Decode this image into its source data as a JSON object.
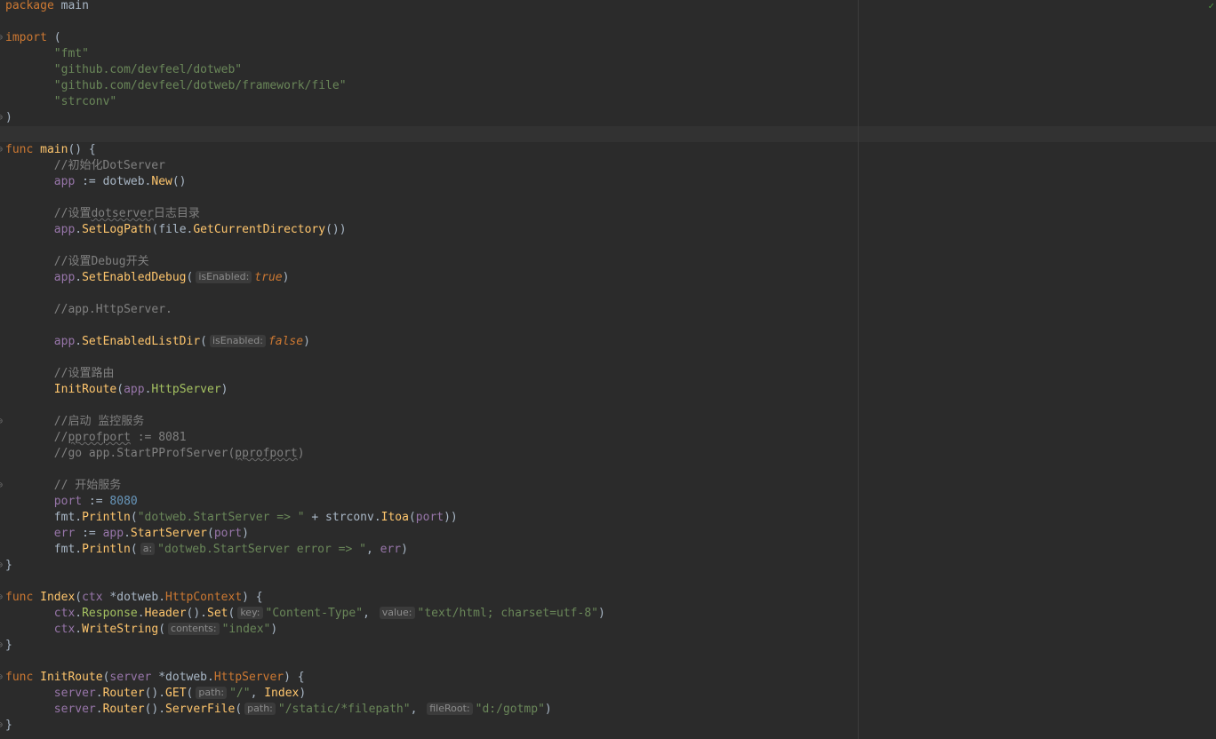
{
  "editor": {
    "inspection_icon": "checkmark-icon",
    "lines": [
      {
        "tokens": [
          {
            "c": "kw",
            "t": "package"
          },
          {
            "c": "plain",
            "t": " main"
          }
        ]
      },
      {
        "tokens": []
      },
      {
        "fold": true,
        "tokens": [
          {
            "c": "kw",
            "t": "import"
          },
          {
            "c": "plain",
            "t": " ("
          }
        ]
      },
      {
        "tokens": [
          {
            "c": "plain",
            "t": "       "
          },
          {
            "c": "str",
            "t": "\"fmt\""
          }
        ]
      },
      {
        "tokens": [
          {
            "c": "plain",
            "t": "       "
          },
          {
            "c": "str",
            "t": "\"github.com/devfeel/dotweb\""
          }
        ]
      },
      {
        "tokens": [
          {
            "c": "plain",
            "t": "       "
          },
          {
            "c": "str",
            "t": "\"github.com/devfeel/dotweb/framework/file\""
          }
        ]
      },
      {
        "tokens": [
          {
            "c": "plain",
            "t": "       "
          },
          {
            "c": "str",
            "t": "\"strconv\""
          }
        ]
      },
      {
        "fold": true,
        "tokens": [
          {
            "c": "plain",
            "t": ")"
          }
        ]
      },
      {
        "tokens": []
      },
      {
        "fold": true,
        "tokens": [
          {
            "c": "kw",
            "t": "func"
          },
          {
            "c": "plain",
            "t": " "
          },
          {
            "c": "fn",
            "t": "main"
          },
          {
            "c": "plain",
            "t": "() {"
          }
        ]
      },
      {
        "tokens": [
          {
            "c": "plain",
            "t": "       "
          },
          {
            "c": "cm",
            "t": "//初始化DotServer"
          }
        ]
      },
      {
        "tokens": [
          {
            "c": "plain",
            "t": "       "
          },
          {
            "c": "var",
            "t": "app"
          },
          {
            "c": "plain",
            "t": " := dotweb."
          },
          {
            "c": "fn",
            "t": "New"
          },
          {
            "c": "plain",
            "t": "()"
          }
        ]
      },
      {
        "tokens": []
      },
      {
        "tokens": [
          {
            "c": "plain",
            "t": "       "
          },
          {
            "c": "cm",
            "t": "//设置"
          },
          {
            "c": "cm wavy",
            "t": "dotserver"
          },
          {
            "c": "cm",
            "t": "日志目录"
          }
        ]
      },
      {
        "tokens": [
          {
            "c": "plain",
            "t": "       "
          },
          {
            "c": "var",
            "t": "app"
          },
          {
            "c": "plain",
            "t": "."
          },
          {
            "c": "fn",
            "t": "SetLogPath"
          },
          {
            "c": "plain",
            "t": "(file."
          },
          {
            "c": "fn",
            "t": "GetCurrentDirectory"
          },
          {
            "c": "plain",
            "t": "())"
          }
        ]
      },
      {
        "tokens": []
      },
      {
        "tokens": [
          {
            "c": "plain",
            "t": "       "
          },
          {
            "c": "cm",
            "t": "//设置Debug开关"
          }
        ]
      },
      {
        "tokens": [
          {
            "c": "plain",
            "t": "       "
          },
          {
            "c": "var",
            "t": "app"
          },
          {
            "c": "plain",
            "t": "."
          },
          {
            "c": "fn",
            "t": "SetEnabledDebug"
          },
          {
            "c": "plain",
            "t": "("
          },
          {
            "c": "hint",
            "t": "isEnabled:"
          },
          {
            "c": "hlc",
            "t": "true"
          },
          {
            "c": "plain",
            "t": ")"
          }
        ]
      },
      {
        "tokens": []
      },
      {
        "tokens": [
          {
            "c": "plain",
            "t": "       "
          },
          {
            "c": "cm",
            "t": "//app.HttpServer."
          }
        ]
      },
      {
        "tokens": []
      },
      {
        "tokens": [
          {
            "c": "plain",
            "t": "       "
          },
          {
            "c": "var",
            "t": "app"
          },
          {
            "c": "plain",
            "t": "."
          },
          {
            "c": "fn",
            "t": "SetEnabledListDir"
          },
          {
            "c": "plain",
            "t": "("
          },
          {
            "c": "hint",
            "t": "isEnabled:"
          },
          {
            "c": "hlc",
            "t": "false"
          },
          {
            "c": "plain",
            "t": ")"
          }
        ]
      },
      {
        "tokens": []
      },
      {
        "tokens": [
          {
            "c": "plain",
            "t": "       "
          },
          {
            "c": "cm",
            "t": "//设置路由"
          }
        ]
      },
      {
        "tokens": [
          {
            "c": "plain",
            "t": "       "
          },
          {
            "c": "fn",
            "t": "InitRoute"
          },
          {
            "c": "plain",
            "t": "("
          },
          {
            "c": "var",
            "t": "app"
          },
          {
            "c": "plain",
            "t": "."
          },
          {
            "c": "typ",
            "t": "HttpServer"
          },
          {
            "c": "plain",
            "t": ")"
          }
        ]
      },
      {
        "tokens": []
      },
      {
        "fold": true,
        "tokens": [
          {
            "c": "plain",
            "t": "       "
          },
          {
            "c": "cm",
            "t": "//启动 监控服务"
          }
        ]
      },
      {
        "tokens": [
          {
            "c": "plain",
            "t": "       "
          },
          {
            "c": "cm",
            "t": "//"
          },
          {
            "c": "cm wavy",
            "t": "pprofport"
          },
          {
            "c": "cm",
            "t": " := 8081"
          }
        ]
      },
      {
        "tokens": [
          {
            "c": "plain",
            "t": "       "
          },
          {
            "c": "cm",
            "t": "//go app.StartPProfServer("
          },
          {
            "c": "cm wavy",
            "t": "pprofport"
          },
          {
            "c": "cm",
            "t": ")"
          }
        ]
      },
      {
        "tokens": []
      },
      {
        "fold": true,
        "tokens": [
          {
            "c": "plain",
            "t": "       "
          },
          {
            "c": "cm",
            "t": "// 开始服务"
          }
        ]
      },
      {
        "tokens": [
          {
            "c": "plain",
            "t": "       "
          },
          {
            "c": "var",
            "t": "port"
          },
          {
            "c": "plain",
            "t": " := "
          },
          {
            "c": "num",
            "t": "8080"
          }
        ]
      },
      {
        "tokens": [
          {
            "c": "plain",
            "t": "       fmt."
          },
          {
            "c": "fn",
            "t": "Println"
          },
          {
            "c": "plain",
            "t": "("
          },
          {
            "c": "str",
            "t": "\"dotweb.StartServer => \""
          },
          {
            "c": "plain",
            "t": " + strconv."
          },
          {
            "c": "fn",
            "t": "Itoa"
          },
          {
            "c": "plain",
            "t": "("
          },
          {
            "c": "var",
            "t": "port"
          },
          {
            "c": "plain",
            "t": "))"
          }
        ]
      },
      {
        "tokens": [
          {
            "c": "plain",
            "t": "       "
          },
          {
            "c": "var",
            "t": "err"
          },
          {
            "c": "plain",
            "t": " := "
          },
          {
            "c": "var",
            "t": "app"
          },
          {
            "c": "plain",
            "t": "."
          },
          {
            "c": "fn",
            "t": "StartServer"
          },
          {
            "c": "plain",
            "t": "("
          },
          {
            "c": "var",
            "t": "port"
          },
          {
            "c": "plain",
            "t": ")"
          }
        ]
      },
      {
        "tokens": [
          {
            "c": "plain",
            "t": "       fmt."
          },
          {
            "c": "fn",
            "t": "Println"
          },
          {
            "c": "plain",
            "t": "("
          },
          {
            "c": "hint",
            "t": "a:"
          },
          {
            "c": "str",
            "t": "\"dotweb.StartServer error => \""
          },
          {
            "c": "plain",
            "t": ", "
          },
          {
            "c": "var",
            "t": "err"
          },
          {
            "c": "plain",
            "t": ")"
          }
        ]
      },
      {
        "fold": true,
        "tokens": [
          {
            "c": "plain",
            "t": "}"
          }
        ]
      },
      {
        "tokens": []
      },
      {
        "fold": true,
        "tokens": [
          {
            "c": "kw",
            "t": "func"
          },
          {
            "c": "plain",
            "t": " "
          },
          {
            "c": "fn",
            "t": "Index"
          },
          {
            "c": "plain",
            "t": "("
          },
          {
            "c": "var",
            "t": "ctx"
          },
          {
            "c": "plain",
            "t": " *dotweb."
          },
          {
            "c": "kw",
            "t": "HttpContext"
          },
          {
            "c": "plain",
            "t": ") {"
          }
        ]
      },
      {
        "tokens": [
          {
            "c": "plain",
            "t": "       "
          },
          {
            "c": "var",
            "t": "ctx"
          },
          {
            "c": "plain",
            "t": "."
          },
          {
            "c": "typ",
            "t": "Response"
          },
          {
            "c": "plain",
            "t": "."
          },
          {
            "c": "fn",
            "t": "Header"
          },
          {
            "c": "plain",
            "t": "()."
          },
          {
            "c": "fn",
            "t": "Set"
          },
          {
            "c": "plain",
            "t": "("
          },
          {
            "c": "hint",
            "t": "key:"
          },
          {
            "c": "str",
            "t": "\"Content-Type\""
          },
          {
            "c": "plain",
            "t": ", "
          },
          {
            "c": "hint",
            "t": "value:"
          },
          {
            "c": "str",
            "t": "\"text/html; charset=utf-8\""
          },
          {
            "c": "plain",
            "t": ")"
          }
        ]
      },
      {
        "tokens": [
          {
            "c": "plain",
            "t": "       "
          },
          {
            "c": "var",
            "t": "ctx"
          },
          {
            "c": "plain",
            "t": "."
          },
          {
            "c": "fn",
            "t": "WriteString"
          },
          {
            "c": "plain",
            "t": "("
          },
          {
            "c": "hint",
            "t": "contents:"
          },
          {
            "c": "str",
            "t": "\"index\""
          },
          {
            "c": "plain",
            "t": ")"
          }
        ]
      },
      {
        "fold": true,
        "tokens": [
          {
            "c": "plain",
            "t": "}"
          }
        ]
      },
      {
        "tokens": []
      },
      {
        "fold": true,
        "tokens": [
          {
            "c": "kw",
            "t": "func"
          },
          {
            "c": "plain",
            "t": " "
          },
          {
            "c": "fn",
            "t": "InitRoute"
          },
          {
            "c": "plain",
            "t": "("
          },
          {
            "c": "var",
            "t": "server"
          },
          {
            "c": "plain",
            "t": " *dotweb."
          },
          {
            "c": "kw",
            "t": "HttpServer"
          },
          {
            "c": "plain",
            "t": ") {"
          }
        ]
      },
      {
        "tokens": [
          {
            "c": "plain",
            "t": "       "
          },
          {
            "c": "var",
            "t": "server"
          },
          {
            "c": "plain",
            "t": "."
          },
          {
            "c": "fn",
            "t": "Router"
          },
          {
            "c": "plain",
            "t": "()."
          },
          {
            "c": "fn",
            "t": "GET"
          },
          {
            "c": "plain",
            "t": "("
          },
          {
            "c": "hint",
            "t": "path:"
          },
          {
            "c": "str",
            "t": "\"/\""
          },
          {
            "c": "plain",
            "t": ", "
          },
          {
            "c": "fn",
            "t": "Index"
          },
          {
            "c": "plain",
            "t": ")"
          }
        ]
      },
      {
        "tokens": [
          {
            "c": "plain",
            "t": "       "
          },
          {
            "c": "var",
            "t": "server"
          },
          {
            "c": "plain",
            "t": "."
          },
          {
            "c": "fn",
            "t": "Router"
          },
          {
            "c": "plain",
            "t": "()."
          },
          {
            "c": "fn",
            "t": "ServerFile"
          },
          {
            "c": "plain",
            "t": "("
          },
          {
            "c": "hint",
            "t": "path:"
          },
          {
            "c": "str",
            "t": "\"/static/*filepath\""
          },
          {
            "c": "plain",
            "t": ", "
          },
          {
            "c": "hint",
            "t": "fileRoot:"
          },
          {
            "c": "str",
            "t": "\"d:/gotmp\""
          },
          {
            "c": "plain",
            "t": ")"
          }
        ]
      },
      {
        "fold": true,
        "tokens": [
          {
            "c": "plain",
            "t": "}"
          }
        ]
      }
    ]
  }
}
